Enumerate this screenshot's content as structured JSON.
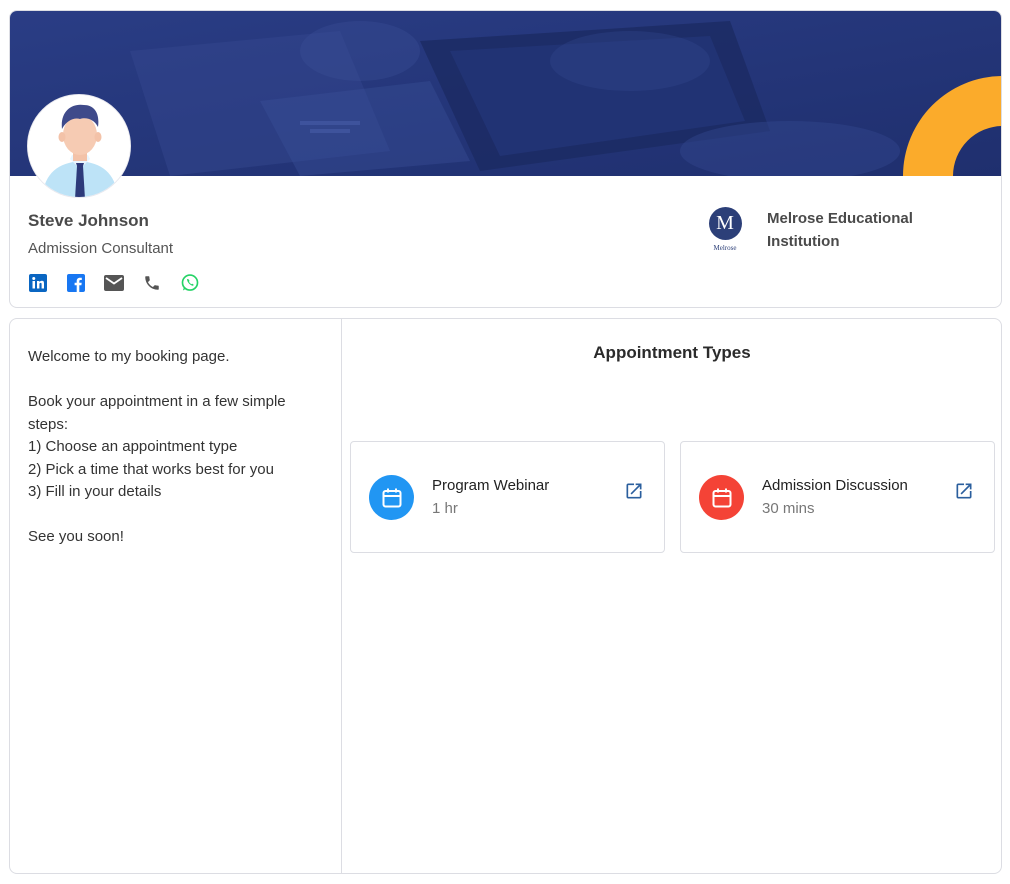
{
  "profile": {
    "name": "Steve Johnson",
    "title": "Admission Consultant",
    "socials": [
      {
        "icon": "linkedin-icon",
        "color": "#0a66c2"
      },
      {
        "icon": "facebook-icon",
        "color": "#1877f2"
      },
      {
        "icon": "email-icon",
        "color": "#555555"
      },
      {
        "icon": "phone-icon",
        "color": "#555555"
      },
      {
        "icon": "whatsapp-icon",
        "color": "#25d366"
      }
    ]
  },
  "organization": {
    "logo_letter": "M",
    "logo_caption": "Melrose",
    "name": "Melrose Educational Institution"
  },
  "welcome": {
    "line1": "Welcome to my booking page.",
    "line2": "Book your appointment in a few simple steps:",
    "step1": "1) Choose an appointment type",
    "step2": "2) Pick a time that works best for you",
    "step3": "3) Fill in your details",
    "closing": "See you soon!"
  },
  "appointments": {
    "title": "Appointment Types",
    "items": [
      {
        "name": "Program Webinar",
        "duration": "1 hr",
        "color": "#2196f3",
        "icon": "calendar-icon"
      },
      {
        "name": "Admission Discussion",
        "duration": "30 mins",
        "color": "#f44336",
        "icon": "calendar-icon"
      }
    ]
  },
  "colors": {
    "banner": "#24367a",
    "accent_orange": "#fbab2b",
    "link_icon": "#2b5f9e"
  }
}
